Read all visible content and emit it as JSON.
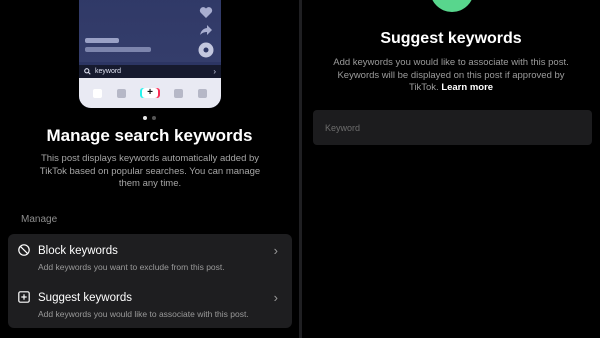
{
  "left_panel": {
    "preview": {
      "search_text": "keyword",
      "icons": [
        "heart-icon",
        "share-icon",
        "music-disc-icon",
        "search-icon",
        "chevron-right-icon",
        "plus-icon"
      ]
    },
    "title": "Manage search keywords",
    "description": "This post displays keywords automatically added by TikTok based on popular searches. You can manage them any time.",
    "section_label": "Manage",
    "options": [
      {
        "title": "Block keywords",
        "subtitle": "Add keywords you want to exclude from this post.",
        "icon": "block-icon"
      },
      {
        "title": "Suggest keywords",
        "subtitle": "Add keywords you would like to associate with this post.",
        "icon": "add-square-icon"
      }
    ],
    "pagination": {
      "current": 1,
      "total": 2
    }
  },
  "right_panel": {
    "title": "Suggest keywords",
    "description": "Add keywords you would like to associate with this post. Keywords will be displayed on this post if approved by TikTok.",
    "learn_more": "Learn more",
    "input": {
      "placeholder": "Keyword",
      "value": ""
    }
  },
  "colors": {
    "background": "#000000",
    "card": "#1e1e20",
    "accent_green": "#58d68d",
    "preview_blue": "#2c3563"
  }
}
